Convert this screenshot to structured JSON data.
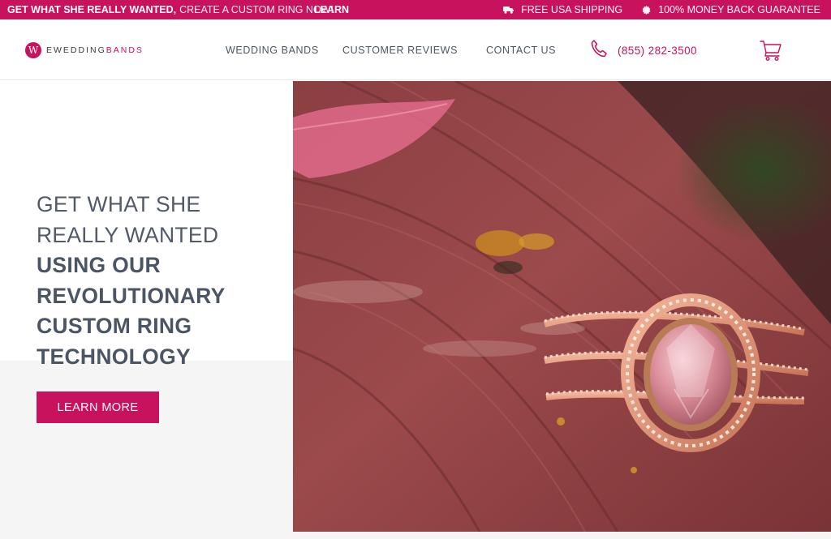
{
  "promo": {
    "headline_strong": "GET WHAT SHE REALLY WANTED,",
    "headline_light": "CREATE A CUSTOM RING NOW!",
    "learn_label": "LEARN",
    "shipping_label": "FREE USA SHIPPING",
    "guarantee_label": "100% MONEY BACK GUARANTEE",
    "shipping_icon": "truck-icon",
    "guarantee_icon": "badge-icon"
  },
  "header": {
    "logo": {
      "part1": "EWEDDING",
      "part2": "BANDS",
      "mark": "W"
    },
    "nav": [
      {
        "label": "WEDDING BANDS"
      },
      {
        "label": "CUSTOMER REVIEWS"
      },
      {
        "label": "CONTACT US"
      }
    ],
    "phone": {
      "number": "(855) 282-3500",
      "icon": "phone-icon"
    },
    "cart_icon": "cart-icon"
  },
  "hero": {
    "lines_light": [
      "GET WHAT SHE",
      "REALLY WANTED"
    ],
    "lines_bold": [
      "USING OUR",
      "REVOLUTIONARY",
      "CUSTOM RING",
      "TECHNOLOGY"
    ],
    "cta_label": "LEARN MORE",
    "image": "rose-gold-halo-ring-on-wooden-bench"
  },
  "colors": {
    "brand": "#c8125e",
    "text": "#4b5563",
    "panel_bg": "#f5f5f5"
  }
}
